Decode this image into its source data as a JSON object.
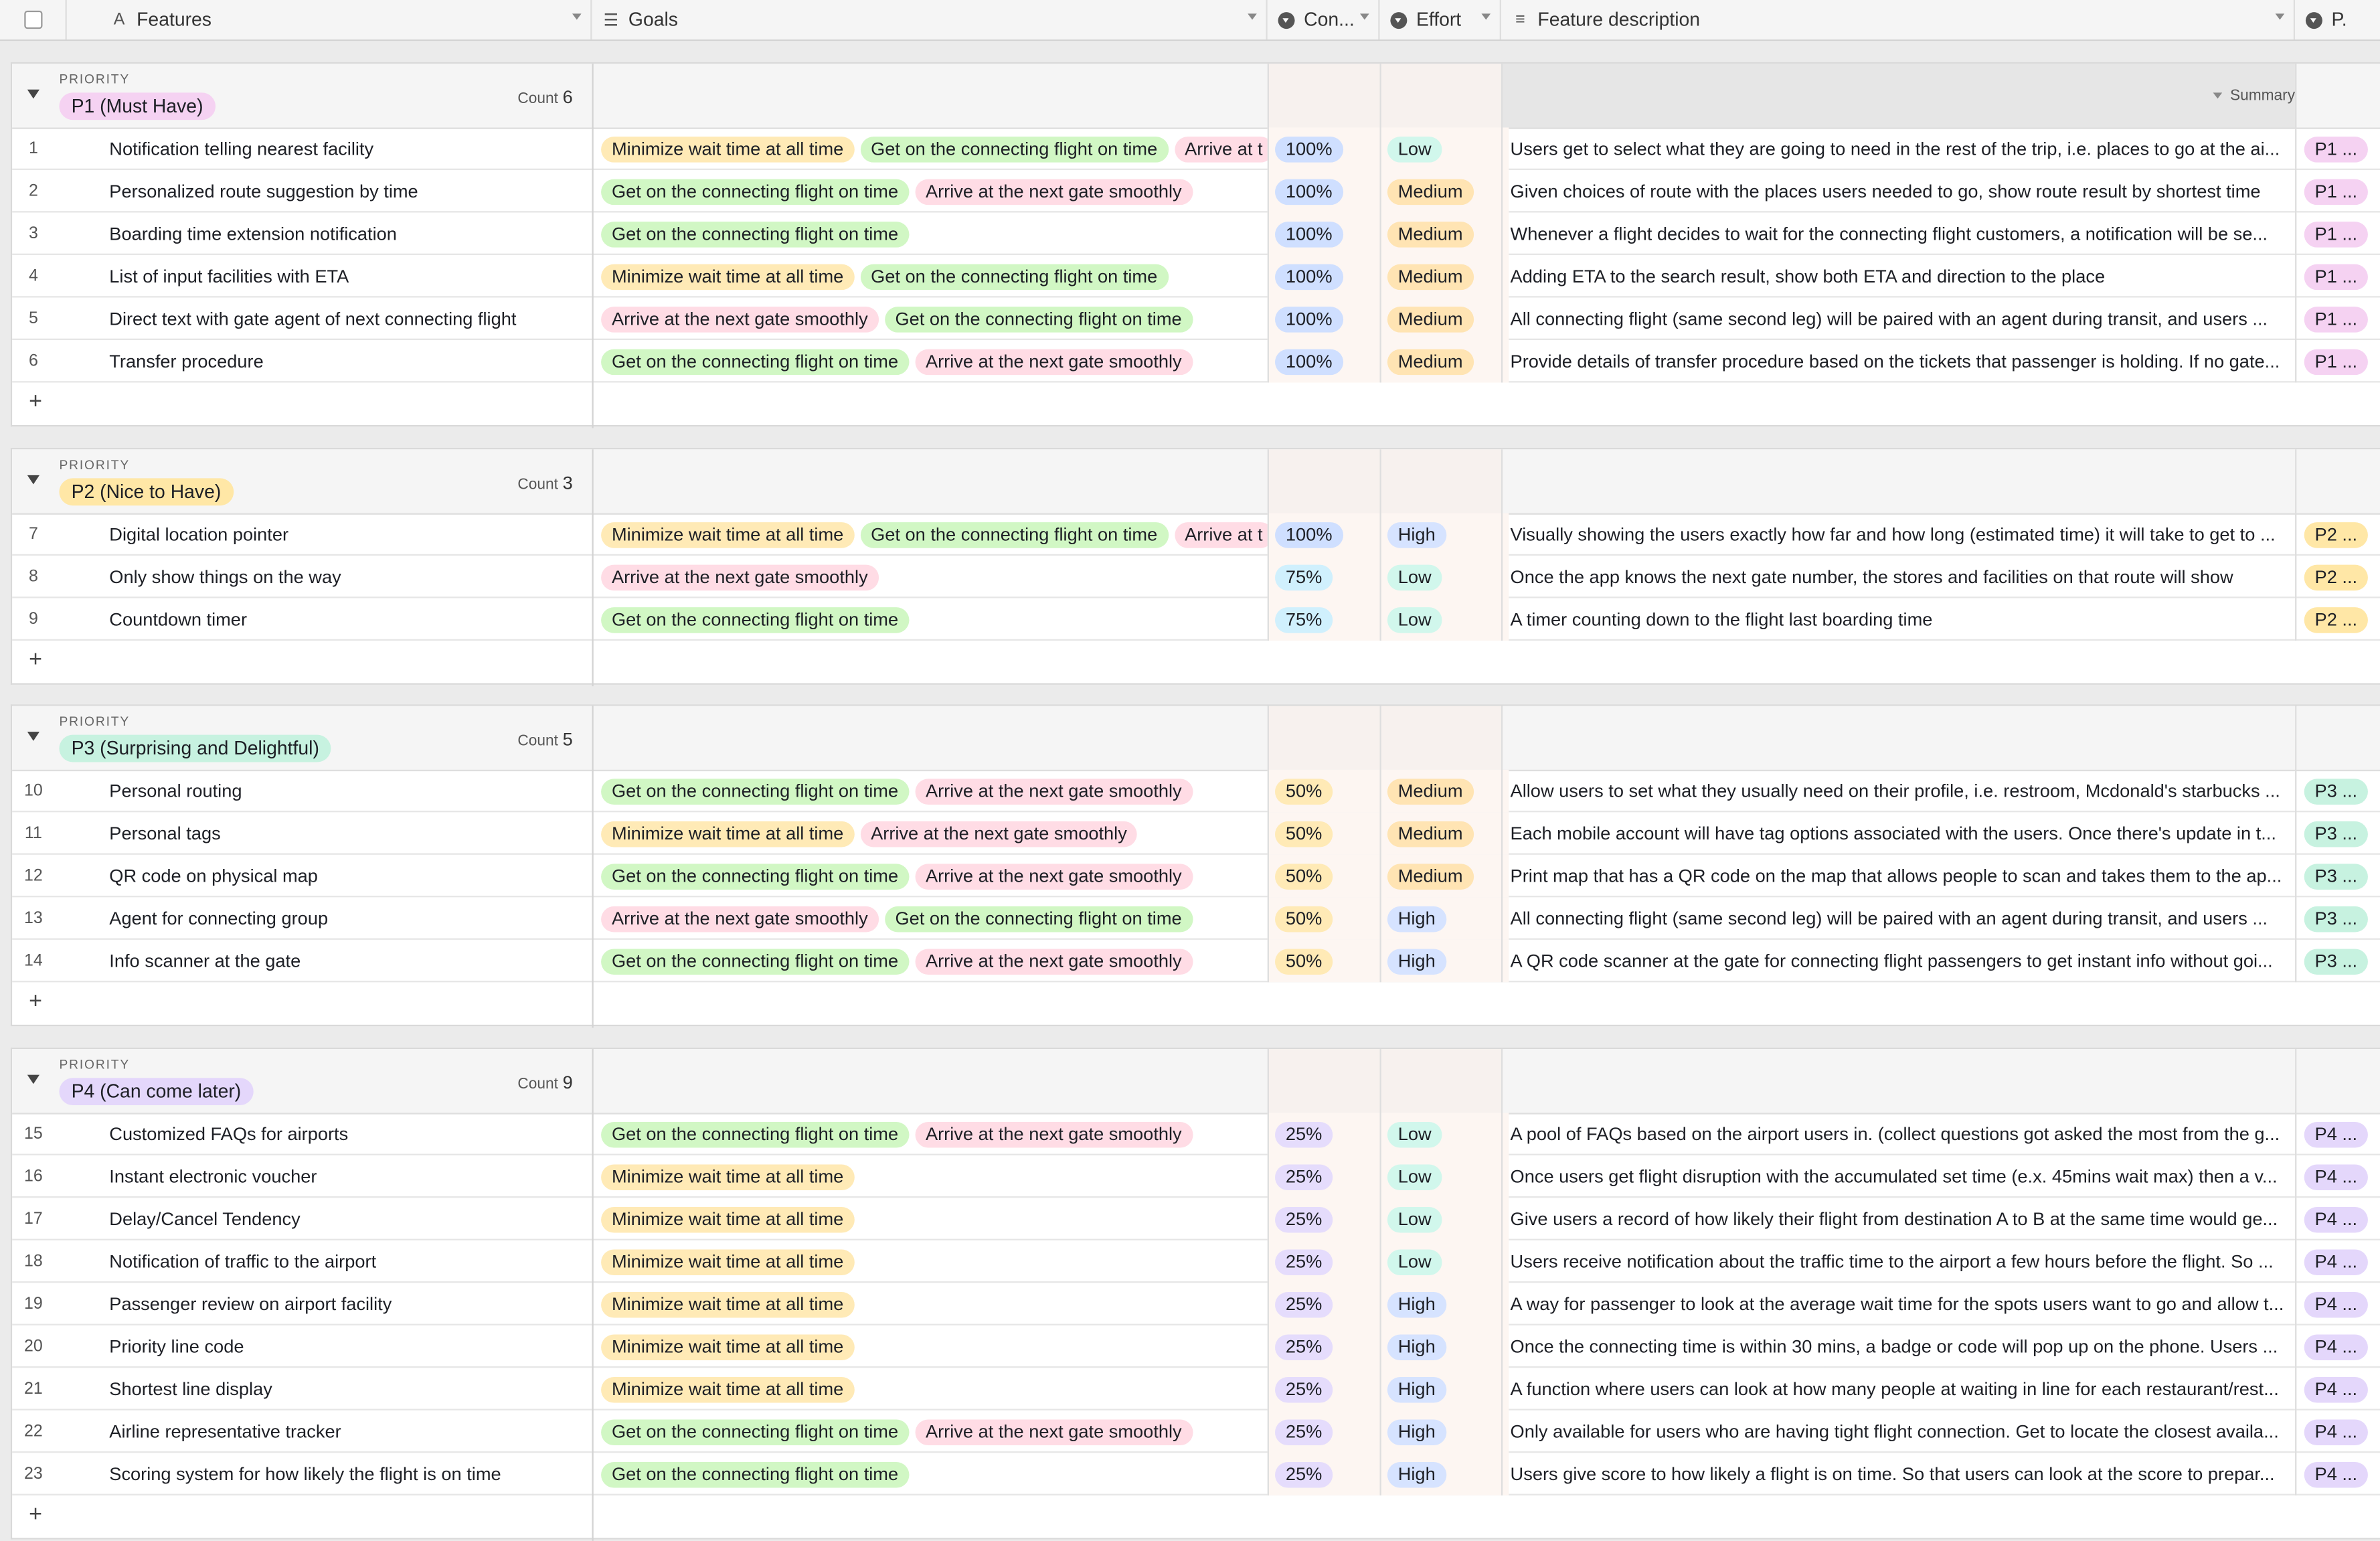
{
  "header": {
    "columns": [
      {
        "label": "Features",
        "icon": "text-field-icon"
      },
      {
        "label": "Goals",
        "icon": "multiselect-icon"
      },
      {
        "label": "Con...",
        "icon": "single-select-icon"
      },
      {
        "label": "Effort",
        "icon": "single-select-icon"
      },
      {
        "label": "Feature description",
        "icon": "long-text-icon"
      },
      {
        "label": "P.",
        "icon": "single-select-icon"
      }
    ]
  },
  "group_caption": "PRIORITY",
  "count_label": "Count",
  "summary_label": "Summary",
  "add_label": "+",
  "goal_colors": {
    "Minimize wait time at all time": "#ffeab6",
    "Get on the connecting flight on time": "#d1f7c4",
    "Arrive at the next gate smoothly": "#ffdce5"
  },
  "groups": [
    {
      "name": "P1 (Must Have)",
      "count": "6",
      "color": "#f5d2f2",
      "tag": "P1 ...",
      "rows": [
        {
          "n": "1",
          "feature": "Notification telling nearest facility",
          "goals": [
            "Minimize wait time at all time",
            "Get on the connecting flight on time",
            "Arrive at t"
          ],
          "con": "100%",
          "effort": "Low",
          "desc": "Users get to select what they are going to need in the rest of the trip, i.e. places to go at the ai..."
        },
        {
          "n": "2",
          "feature": "Personalized route suggestion by time",
          "goals": [
            "Get on the connecting flight on time",
            "Arrive at the next gate smoothly"
          ],
          "con": "100%",
          "effort": "Medium",
          "desc": "Given choices of route with the places users needed to go, show route result by shortest time"
        },
        {
          "n": "3",
          "feature": "Boarding time extension notification",
          "goals": [
            "Get on the connecting flight on time"
          ],
          "con": "100%",
          "effort": "Medium",
          "desc": "Whenever a flight decides to wait for the connecting flight customers, a notification will be se..."
        },
        {
          "n": "4",
          "feature": "List of input facilities with ETA",
          "goals": [
            "Minimize wait time at all time",
            "Get on the connecting flight on time"
          ],
          "con": "100%",
          "effort": "Medium",
          "desc": "Adding ETA to the search result, show both ETA and direction to the place"
        },
        {
          "n": "5",
          "feature": "Direct text with gate agent of next connecting flight",
          "goals": [
            "Arrive at the next gate smoothly",
            "Get on the connecting flight on time"
          ],
          "con": "100%",
          "effort": "Medium",
          "desc": "All connecting flight (same second leg) will be paired with an agent during transit, and users ..."
        },
        {
          "n": "6",
          "feature": "Transfer procedure",
          "goals": [
            "Get on the connecting flight on time",
            "Arrive at the next gate smoothly"
          ],
          "con": "100%",
          "effort": "Medium",
          "desc": "Provide details of transfer procedure based on the tickets that passenger is holding. If no gate..."
        }
      ]
    },
    {
      "name": "P2 (Nice to Have)",
      "count": "3",
      "color": "#ffe7a6",
      "tag": "P2 ...",
      "rows": [
        {
          "n": "7",
          "feature": "Digital location pointer",
          "goals": [
            "Minimize wait time at all time",
            "Get on the connecting flight on time",
            "Arrive at t"
          ],
          "con": "100%",
          "effort": "High",
          "desc": "Visually showing the users exactly how far and how long (estimated time) it will take to get to ..."
        },
        {
          "n": "8",
          "feature": "Only show things on the way",
          "goals": [
            "Arrive at the next gate smoothly"
          ],
          "con": "75%",
          "effort": "Low",
          "desc": "Once the app knows the next gate number, the stores and facilities on that route will show"
        },
        {
          "n": "9",
          "feature": "Countdown timer",
          "goals": [
            "Get on the connecting flight on time"
          ],
          "con": "75%",
          "effort": "Low",
          "desc": "A timer counting down to the flight last boarding time"
        }
      ]
    },
    {
      "name": "P3 (Surprising and Delightful)",
      "count": "5",
      "color": "#c7f2e0",
      "tag": "P3 ...",
      "rows": [
        {
          "n": "10",
          "feature": "Personal routing",
          "goals": [
            "Get on the connecting flight on time",
            "Arrive at the next gate smoothly"
          ],
          "con": "50%",
          "effort": "Medium",
          "desc": "Allow users to set what they usually need on their profile, i.e. restroom, Mcdonald's starbucks ..."
        },
        {
          "n": "11",
          "feature": "Personal tags",
          "goals": [
            "Minimize wait time at all time",
            "Arrive at the next gate smoothly"
          ],
          "con": "50%",
          "effort": "Medium",
          "desc": "Each mobile account will have tag options associated with the users. Once there's update in t..."
        },
        {
          "n": "12",
          "feature": "QR code on physical map",
          "goals": [
            "Get on the connecting flight on time",
            "Arrive at the next gate smoothly"
          ],
          "con": "50%",
          "effort": "Medium",
          "desc": "Print map that has a QR code on the map that allows people to scan and takes them to the ap..."
        },
        {
          "n": "13",
          "feature": "Agent for connecting group",
          "goals": [
            "Arrive at the next gate smoothly",
            "Get on the connecting flight on time"
          ],
          "con": "50%",
          "effort": "High",
          "desc": "All connecting flight (same second leg) will be paired with an agent during transit, and users ..."
        },
        {
          "n": "14",
          "feature": "Info scanner at the gate",
          "goals": [
            "Get on the connecting flight on time",
            "Arrive at the next gate smoothly"
          ],
          "con": "50%",
          "effort": "High",
          "desc": "A QR code scanner at the gate for connecting flight passengers to get instant info without goi..."
        }
      ]
    },
    {
      "name": "P4 (Can come later)",
      "count": "9",
      "color": "#e4d7fb",
      "tag": "P4 ...",
      "rows": [
        {
          "n": "15",
          "feature": "Customized FAQs for airports",
          "goals": [
            "Get on the connecting flight on time",
            "Arrive at the next gate smoothly"
          ],
          "con": "25%",
          "effort": "Low",
          "desc": "A pool of FAQs based on the airport users in. (collect questions got asked the most from the g..."
        },
        {
          "n": "16",
          "feature": "Instant electronic voucher",
          "goals": [
            "Minimize wait time at all time"
          ],
          "con": "25%",
          "effort": "Low",
          "desc": "Once users get flight disruption with the accumulated set time (e.x. 45mins wait max) then a v..."
        },
        {
          "n": "17",
          "feature": "Delay/Cancel Tendency",
          "goals": [
            "Minimize wait time at all time"
          ],
          "con": "25%",
          "effort": "Low",
          "desc": "Give users a record of how likely their flight from destination A to B at the same time would ge..."
        },
        {
          "n": "18",
          "feature": "Notification of traffic to the airport",
          "goals": [
            "Minimize wait time at all time"
          ],
          "con": "25%",
          "effort": "Low",
          "desc": "Users receive notification about the traffic time to the airport a few hours before the flight. So ..."
        },
        {
          "n": "19",
          "feature": "Passenger review on airport facility",
          "goals": [
            "Minimize wait time at all time"
          ],
          "con": "25%",
          "effort": "High",
          "desc": "A way for passenger to look at the average wait time for the spots users want to go and allow t..."
        },
        {
          "n": "20",
          "feature": "Priority line code",
          "goals": [
            "Minimize wait time at all time"
          ],
          "con": "25%",
          "effort": "High",
          "desc": "Once the connecting time is within 30 mins, a badge or code will pop up on the phone. Users ..."
        },
        {
          "n": "21",
          "feature": "Shortest line display",
          "goals": [
            "Minimize wait time at all time"
          ],
          "con": "25%",
          "effort": "High",
          "desc": "A function where users can look at how many people at waiting in line for each restaurant/rest..."
        },
        {
          "n": "22",
          "feature": "Airline representative tracker",
          "goals": [
            "Get on the connecting flight on time",
            "Arrive at the next gate smoothly"
          ],
          "con": "25%",
          "effort": "High",
          "desc": "Only available for users who are having tight flight connection. Get to locate the closest availa..."
        },
        {
          "n": "23",
          "feature": "Scoring system for how likely the flight is on time",
          "goals": [
            "Get on the connecting flight on time"
          ],
          "con": "25%",
          "effort": "High",
          "desc": "Users give score to how likely a flight is on time. So that users can look at the score to prepar..."
        }
      ]
    }
  ]
}
